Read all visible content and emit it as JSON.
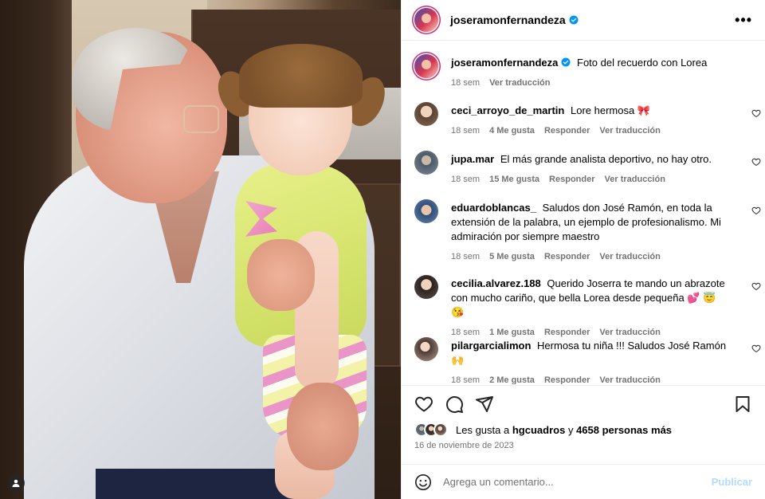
{
  "post": {
    "author": "joseramonfernandeza",
    "verified": true,
    "caption": "Foto del recuerdo con Lorea",
    "caption_time": "18 sem",
    "see_translation": "Ver traducción"
  },
  "header": {
    "more_icon": "more-horizontal-icon"
  },
  "comments": [
    {
      "user": "ceci_arroyo_de_martin",
      "text": "Lore hermosa 🎀",
      "time": "18 sem",
      "likes": "4 Me gusta",
      "reply": "Responder",
      "translate": "Ver traducción"
    },
    {
      "user": "jupa.mar",
      "text": "El más grande analista deportivo, no hay otro.",
      "time": "18 sem",
      "likes": "15 Me gusta",
      "reply": "Responder",
      "translate": "Ver traducción"
    },
    {
      "user": "eduardoblancas_",
      "text": "Saludos don José Ramón, en toda la extensión de la palabra, un ejemplo de profesionalismo. Mi admiración por siempre maestro",
      "time": "18 sem",
      "likes": "5 Me gusta",
      "reply": "Responder",
      "translate": "Ver traducción"
    },
    {
      "user": "cecilia.alvarez.188",
      "text": "Querido Joserra te mando un abrazote con mucho cariño, que bella Lorea desde pequeña 💕 😇 😘",
      "time": "18 sem",
      "likes": "1 Me gusta",
      "reply": "Responder",
      "translate": "Ver traducción"
    },
    {
      "user": "pilargarcialimon",
      "text": "Hermosa tu niña !!! Saludos José Ramón 🙌",
      "time": "18 sem",
      "likes": "2 Me gusta",
      "reply": "Responder",
      "translate": "Ver traducción"
    }
  ],
  "likes": {
    "prefix": "Les gusta a",
    "first_user": "hgcuadros",
    "connector": "y",
    "others": "4658 personas más"
  },
  "date": "16 de noviembre de 2023",
  "add_comment": {
    "placeholder": "Agrega un comentario...",
    "publish": "Publicar"
  },
  "colors": {
    "link_blue": "#0095f6",
    "publish_disabled": "#b3dbff",
    "meta_gray": "#737373",
    "verified_blue": "#0095f6"
  }
}
